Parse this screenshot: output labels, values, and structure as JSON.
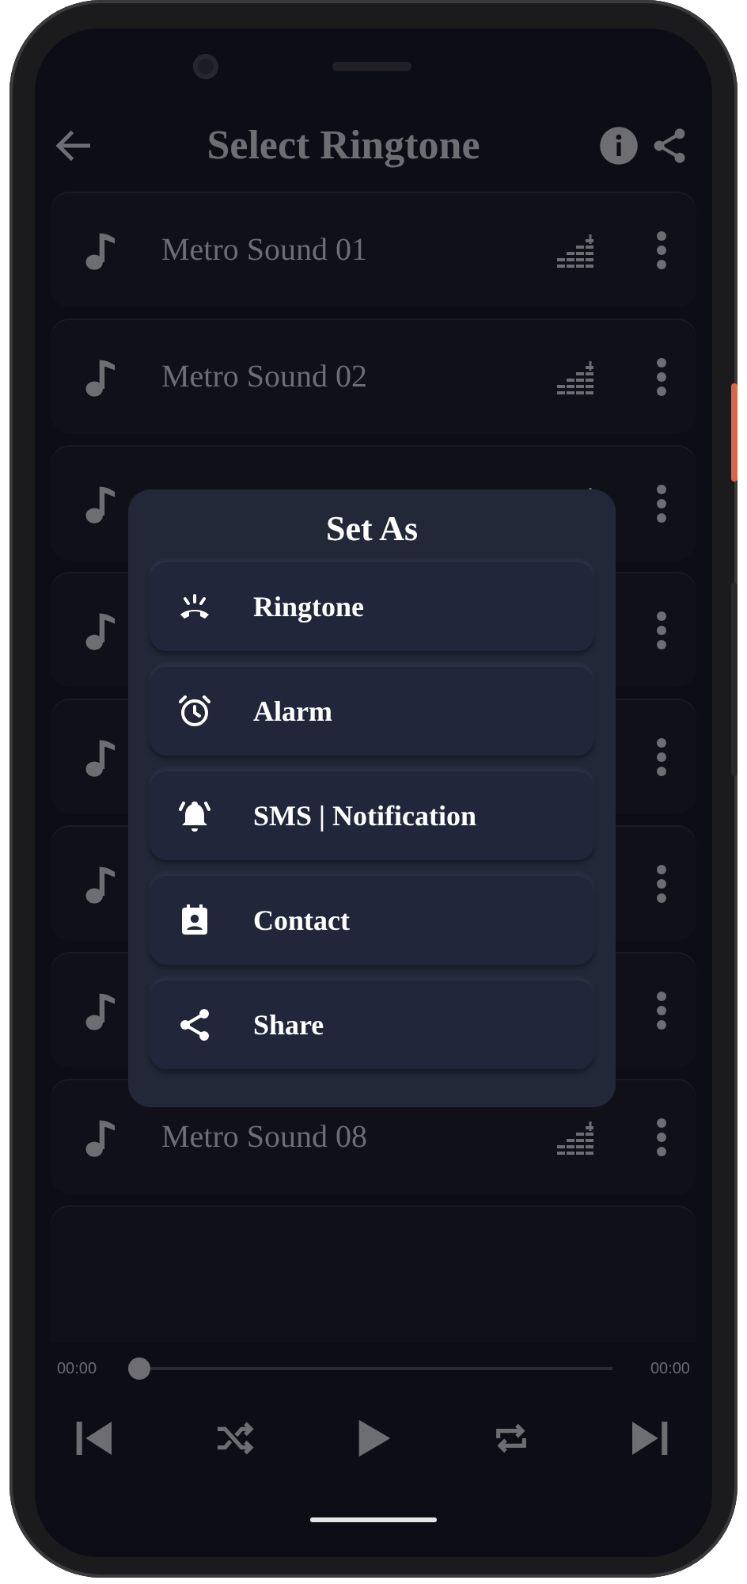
{
  "app_bar": {
    "title": "Select Ringtone"
  },
  "ringtones": [
    {
      "kind": "titled",
      "title": "Metro Sound 01"
    },
    {
      "kind": "titled",
      "title": "Metro Sound 02"
    },
    {
      "kind": "partly_covered"
    },
    {
      "kind": "covered"
    },
    {
      "kind": "covered"
    },
    {
      "kind": "covered"
    },
    {
      "kind": "covered"
    },
    {
      "kind": "titled",
      "title": "Metro Sound 08"
    }
  ],
  "dialog": {
    "title": "Set As",
    "options": [
      {
        "label": "Ringtone"
      },
      {
        "label": "Alarm"
      },
      {
        "label": "SMS | Notification"
      },
      {
        "label": "Contact"
      },
      {
        "label": "Share"
      }
    ]
  },
  "player": {
    "elapsed": "00:00",
    "duration": "00:00",
    "level": 0
  }
}
